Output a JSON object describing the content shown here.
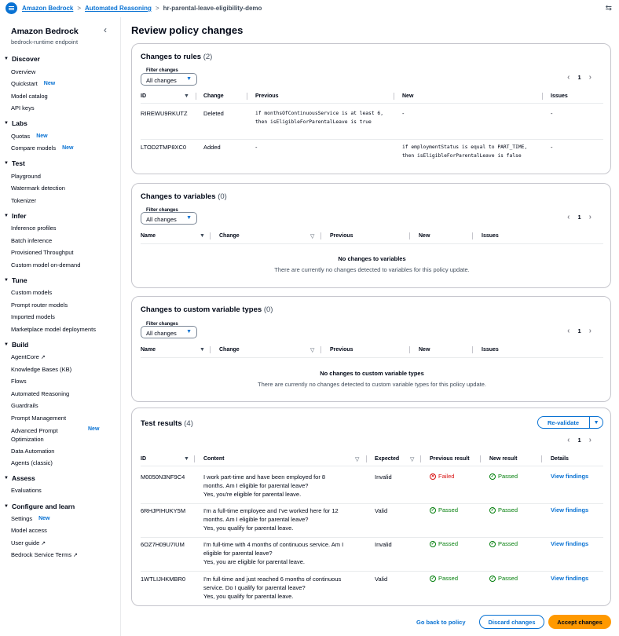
{
  "breadcrumb": {
    "items": [
      "Amazon Bedrock",
      "Automated Reasoning"
    ],
    "current": "hr-parental-leave-eligibility-demo"
  },
  "sidebar": {
    "title": "Amazon Bedrock",
    "subtitle": "bedrock-runtime endpoint",
    "sections": [
      {
        "label": "Discover",
        "items": [
          {
            "label": "Overview"
          },
          {
            "label": "Quickstart",
            "badge": "New"
          },
          {
            "label": "Model catalog"
          },
          {
            "label": "API keys"
          }
        ]
      },
      {
        "label": "Labs",
        "items": [
          {
            "label": "Quotas",
            "badge": "New"
          },
          {
            "label": "Compare models",
            "badge": "New"
          }
        ]
      },
      {
        "label": "Test",
        "items": [
          {
            "label": "Playground"
          },
          {
            "label": "Watermark detection"
          },
          {
            "label": "Tokenizer"
          }
        ]
      },
      {
        "label": "Infer",
        "items": [
          {
            "label": "Inference profiles"
          },
          {
            "label": "Batch inference"
          },
          {
            "label": "Provisioned Throughput"
          },
          {
            "label": "Custom model on-demand"
          }
        ]
      },
      {
        "label": "Tune",
        "items": [
          {
            "label": "Custom models"
          },
          {
            "label": "Prompt router models"
          },
          {
            "label": "Imported models"
          },
          {
            "label": "Marketplace model deployments"
          }
        ]
      },
      {
        "label": "Build",
        "items": [
          {
            "label": "AgentCore"
          },
          {
            "label": "Knowledge Bases (KB)"
          },
          {
            "label": "Flows"
          },
          {
            "label": "Automated Reasoning"
          },
          {
            "label": "Guardrails"
          },
          {
            "label": "Prompt Management"
          },
          {
            "label": "Advanced Prompt",
            "label2": "Optimization",
            "badge": "New"
          },
          {
            "label": "Data Automation"
          },
          {
            "label": "Agents (classic)"
          }
        ]
      },
      {
        "label": "Assess",
        "items": [
          {
            "label": "Evaluations"
          }
        ]
      },
      {
        "label": "Configure and learn",
        "items": [
          {
            "label": "Settings",
            "badge": "New"
          },
          {
            "label": "Model access"
          },
          {
            "label": "User guide"
          },
          {
            "label": "Bedrock Service Terms"
          }
        ]
      }
    ]
  },
  "page": {
    "title": "Review policy changes"
  },
  "filter": {
    "label": "Filter changes",
    "value": "All changes"
  },
  "pager": {
    "page": "1"
  },
  "rules": {
    "title": "Changes to rules",
    "count": "(2)",
    "columns": [
      "ID",
      "Change",
      "Previous",
      "New",
      "Issues"
    ],
    "rows": [
      {
        "id": "RIREWU9RKUTZ",
        "change": "Deleted",
        "previous": "if monthsOfContinuousService is at least 6, then isEligibleForParentalLeave is true",
        "new": "-",
        "issues": "-"
      },
      {
        "id": "LTOD2TMP8XC0",
        "change": "Added",
        "previous": "-",
        "new": "if employmentStatus is equal to PART_TIME, then isEligibleForParentalLeave is false",
        "issues": "-"
      }
    ]
  },
  "variables": {
    "title": "Changes to variables",
    "count": "(0)",
    "columns": [
      "Name",
      "Change",
      "Previous",
      "New",
      "Issues"
    ],
    "empty_title": "No changes to variables",
    "empty_sub": "There are currently no changes detected to variables for this policy update."
  },
  "types": {
    "title": "Changes to custom variable types",
    "count": "(0)",
    "columns": [
      "Name",
      "Change",
      "Previous",
      "New",
      "Issues"
    ],
    "empty_title": "No changes to custom variable types",
    "empty_sub": "There are currently no changes detected to custom variable types for this policy update."
  },
  "tests": {
    "title": "Test results",
    "count": "(4)",
    "revalidate": "Re-validate",
    "columns": [
      "ID",
      "Content",
      "Expected",
      "Previous result",
      "New result",
      "Details"
    ],
    "rows": [
      {
        "id": "M0050N3NF9C4",
        "q1": "I work part-time and have been employed for 8",
        "q2": "months. Am I eligible for parental leave?",
        "a": "Yes, you're eligible for parental leave.",
        "expected": "Invalid",
        "prev": "Failed",
        "new": "Passed",
        "details": "View findings"
      },
      {
        "id": "6RHJPIHUKY5M",
        "q1": "I'm a full-time employee and I've worked here for 12",
        "q2": "months. Am I eligible for parental leave?",
        "a": "Yes, you qualify for parental leave.",
        "expected": "Valid",
        "prev": "Passed",
        "new": "Passed",
        "details": "View findings"
      },
      {
        "id": "6OZ7H09U7IUM",
        "q1": "I'm full-time with 4 months of continuous service. Am I",
        "q2": "eligible for parental leave?",
        "a": "Yes, you are eligible for parental leave.",
        "expected": "Invalid",
        "prev": "Passed",
        "new": "Passed",
        "details": "View findings"
      },
      {
        "id": "1WTLIJHKMBR0",
        "q1": "I'm full-time and just reached 6 months of continuous",
        "q2": "service. Do I qualify for parental leave?",
        "a": "Yes, you qualify for parental leave.",
        "expected": "Valid",
        "prev": "Passed",
        "new": "Passed",
        "details": "View findings"
      }
    ]
  },
  "footer": {
    "back": "Go back to policy",
    "discard": "Discard changes",
    "accept": "Accept changes"
  },
  "colors": {
    "accent": "#0972d3",
    "primary_button": "#ff9900",
    "success": "#037f0c",
    "error": "#d91515"
  }
}
